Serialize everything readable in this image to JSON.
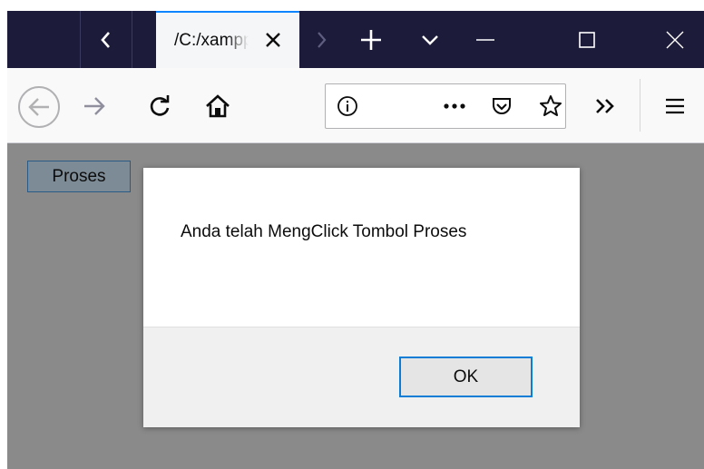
{
  "browser": {
    "tab": {
      "title": "/C:/xampp",
      "close_icon": "close-icon"
    },
    "tabstrip_buttons": [
      "chevron-left-icon",
      "chevron-right-icon",
      "plus-icon",
      "chevron-down-icon",
      "minimize-icon",
      "maximize-icon",
      "close-icon"
    ],
    "urlbar": {
      "value": "",
      "info_icon": "info-icon",
      "more_icon": "ellipsis-icon",
      "pocket_icon": "pocket-icon",
      "bookmark_icon": "star-icon"
    },
    "nav_icons": [
      "back-arrow-icon",
      "forward-arrow-icon",
      "reload-icon",
      "home-icon",
      "overflow-icon",
      "hamburger-menu-icon"
    ]
  },
  "page": {
    "proses_button_label": "Proses"
  },
  "dialog": {
    "message": "Anda telah MengClick Tombol Proses",
    "ok_label": "OK"
  },
  "colors": {
    "tabstrip_bg": "#1c1b3a",
    "tab_accent": "#0a84ff",
    "content_overlay": "#8a8a8a",
    "ok_border": "#0a7ed6"
  }
}
